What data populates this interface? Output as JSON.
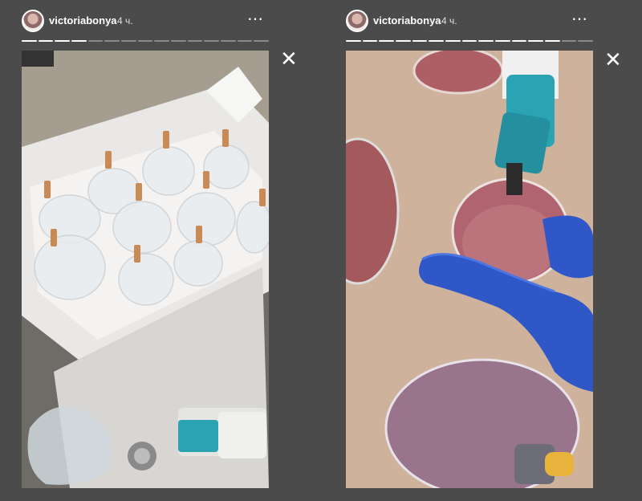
{
  "stories": [
    {
      "username": "victoriabonya",
      "time": "4 ч.",
      "more_icon": "⋯"
    },
    {
      "username": "victoriabonya",
      "time": "4 ч.",
      "more_icon": "⋯"
    }
  ],
  "close_icon": "✕",
  "colors": {
    "background": "#4b4b4b",
    "text": "#ffffff",
    "glove": "#2f57c7",
    "cupValveTeal": "#2aa3b3"
  }
}
